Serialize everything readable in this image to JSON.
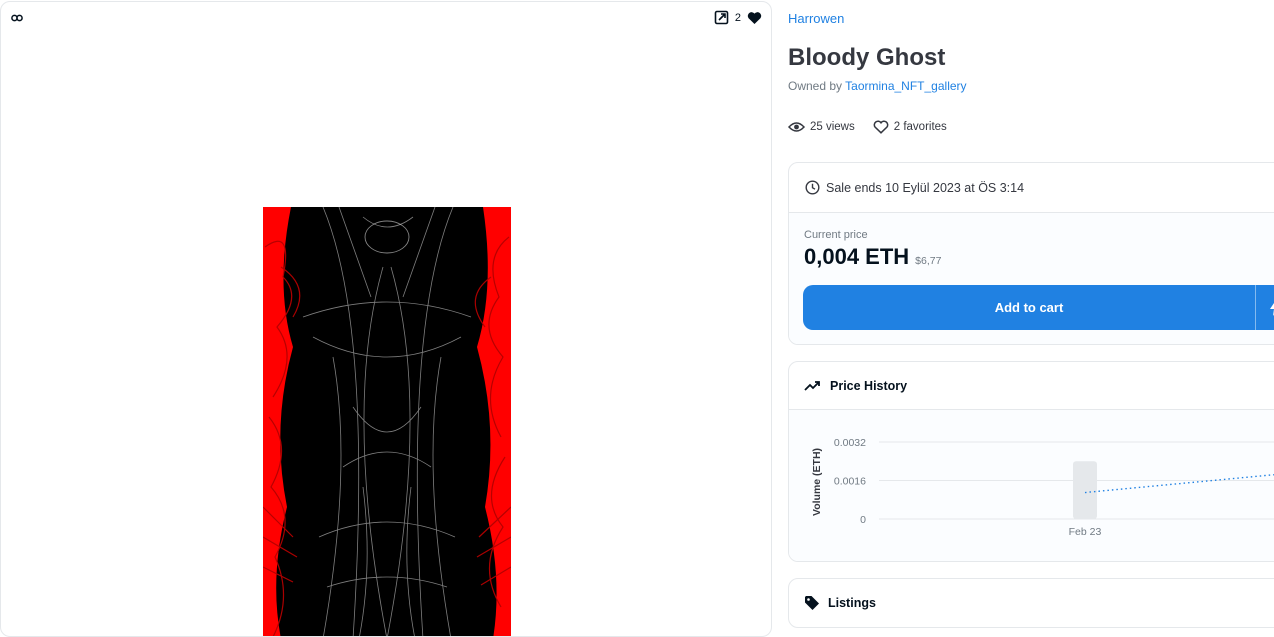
{
  "item": {
    "collection": "Harrowen",
    "title": "Bloody Ghost",
    "owned_by_label": "Owned by",
    "owner": "Taormina_NFT_gallery",
    "views": "25 views",
    "favorites": "2 favorites",
    "favorite_count": "2"
  },
  "icons": {
    "chain": "link-icon",
    "external": "external-link-icon",
    "favorite": "heart-filled-icon",
    "views": "eye-icon",
    "favorites": "heart-outline-icon",
    "clock": "clock-icon",
    "bolt": "bolt-icon",
    "trend": "trending-icon",
    "tag": "tag-icon"
  },
  "sale": {
    "ends_text": "Sale ends 10 Eylül 2023 at ÖS 3:14",
    "current_price_label": "Current price",
    "price_eth": "0,004 ETH",
    "price_usd": "$6,77",
    "add_to_cart": "Add to cart"
  },
  "price_history": {
    "title": "Price History"
  },
  "chart_data": {
    "type": "bar",
    "categories": [
      "Feb 23"
    ],
    "values": [
      0.0024
    ],
    "ylabel": "Volume (ETH)",
    "yticks": [
      "0.0032",
      "0.0016",
      "0"
    ],
    "ylim": [
      0,
      0.0032
    ],
    "trend_line": {
      "style": "dotted",
      "from": 0.0011,
      "to": 0.0019
    },
    "grid": true
  },
  "listings": {
    "title": "Listings"
  },
  "colors": {
    "accent": "#2081e2",
    "artwork_background": "#ff0000"
  }
}
